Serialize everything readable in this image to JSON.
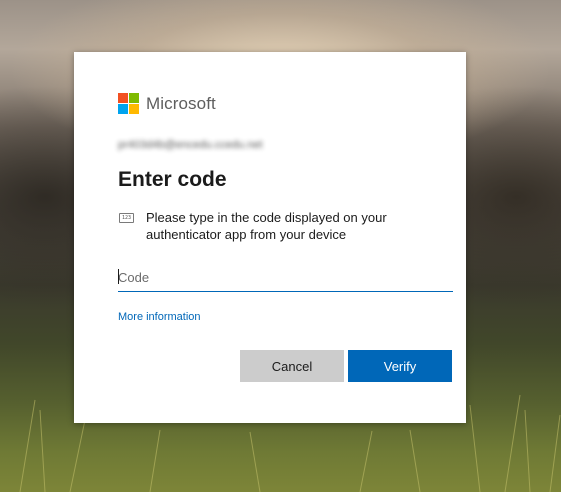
{
  "brand": {
    "name": "Microsoft",
    "logo_colors": [
      "#f25022",
      "#7fba00",
      "#00a4ef",
      "#ffb900"
    ]
  },
  "account": {
    "email": "pr403d4b@encedu.ccedu.net"
  },
  "dialog": {
    "title": "Enter code",
    "instruction_icon": "code-icon",
    "instruction_icon_text": "123",
    "instruction": "Please type in the code displayed on your authenticator app from your device",
    "code_input": {
      "value": "",
      "placeholder": "Code"
    },
    "more_info_link": "More information",
    "cancel_label": "Cancel",
    "verify_label": "Verify"
  },
  "colors": {
    "accent": "#0067b8",
    "cancel_bg": "#cccccc",
    "text": "#1b1b1b"
  }
}
